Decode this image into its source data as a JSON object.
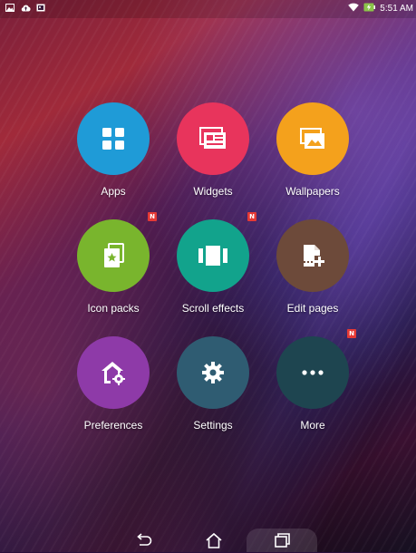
{
  "status_bar": {
    "time": "5:51 AM",
    "left_icons": [
      "image-notification-icon",
      "cloud-upload-icon",
      "gallery-notification-icon"
    ],
    "right_icons": [
      "wifi-icon",
      "battery-charging-icon"
    ]
  },
  "menu": {
    "items": [
      {
        "label": "Apps",
        "color": "#1f9bd7",
        "icon": "grid-icon",
        "badge": ""
      },
      {
        "label": "Widgets",
        "color": "#e8345c",
        "icon": "widgets-icon",
        "badge": ""
      },
      {
        "label": "Wallpapers",
        "color": "#f4a11c",
        "icon": "wallpaper-icon",
        "badge": ""
      },
      {
        "label": "Icon packs",
        "color": "#79b52d",
        "icon": "icon-pack-icon",
        "badge": "N"
      },
      {
        "label": "Scroll effects",
        "color": "#12a38c",
        "icon": "scroll-effects-icon",
        "badge": "N"
      },
      {
        "label": "Edit pages",
        "color": "#6d4a3a",
        "icon": "edit-pages-icon",
        "badge": ""
      },
      {
        "label": "Preferences",
        "color": "#8e3aa8",
        "icon": "home-gear-icon",
        "badge": ""
      },
      {
        "label": "Settings",
        "color": "#2f5c72",
        "icon": "gear-icon",
        "badge": ""
      },
      {
        "label": "More",
        "color": "#1e4550",
        "icon": "more-dots-icon",
        "badge": "N"
      }
    ]
  },
  "nav_bar": {
    "buttons": [
      "back-icon",
      "home-icon",
      "recents-icon"
    ]
  }
}
